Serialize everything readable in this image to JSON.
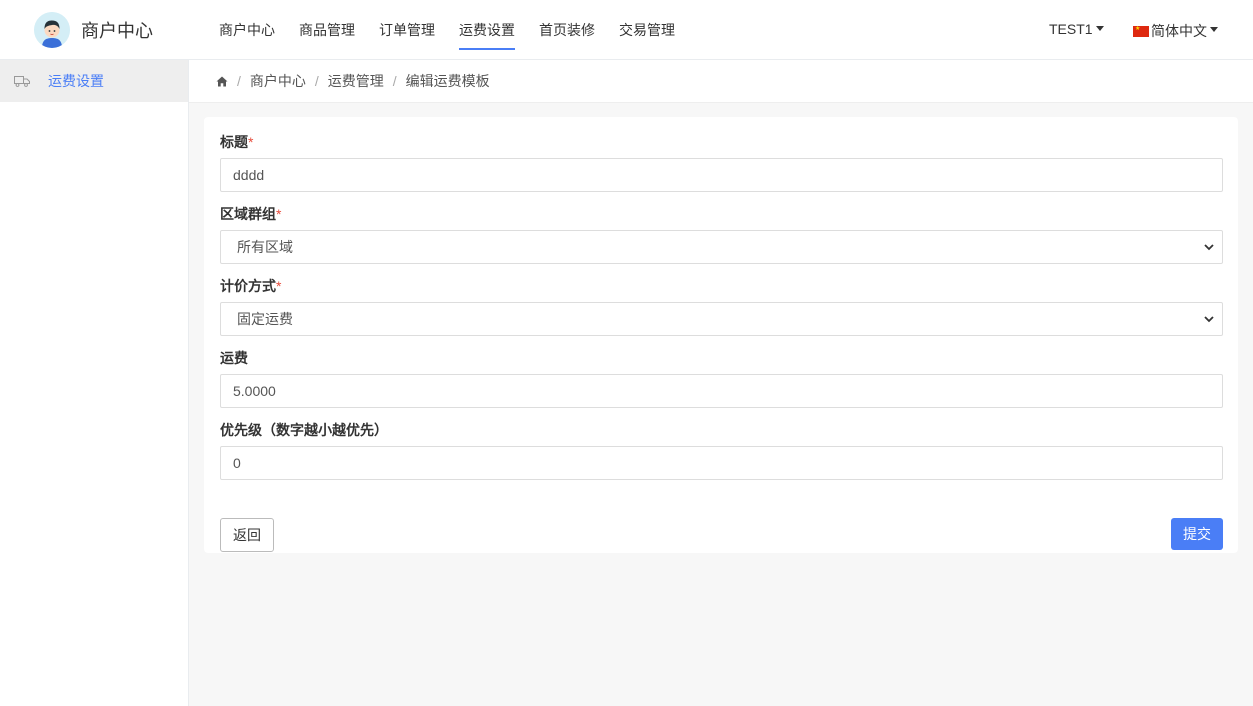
{
  "header": {
    "brand_title": "商户中心",
    "nav": [
      {
        "label": "商户中心",
        "active": false
      },
      {
        "label": "商品管理",
        "active": false
      },
      {
        "label": "订单管理",
        "active": false
      },
      {
        "label": "运费设置",
        "active": true
      },
      {
        "label": "首页装修",
        "active": false
      },
      {
        "label": "交易管理",
        "active": false
      }
    ],
    "user": "TEST1",
    "language": "简体中文"
  },
  "sidebar": {
    "items": [
      {
        "label": "运费设置",
        "icon": "truck-icon",
        "active": true
      }
    ]
  },
  "breadcrumb": {
    "items": [
      "商户中心",
      "运费管理",
      "编辑运费模板"
    ]
  },
  "form": {
    "title": {
      "label": "标题",
      "required_mark": "*",
      "value": "dddd"
    },
    "region": {
      "label": "区域群组",
      "required_mark": "*",
      "value": "所有区域"
    },
    "pricing": {
      "label": "计价方式",
      "required_mark": "*",
      "value": "固定运费"
    },
    "fee": {
      "label": "运费",
      "value": "5.0000"
    },
    "priority": {
      "label": "优先级（数字越小越优先）",
      "value": "0"
    }
  },
  "actions": {
    "back_label": "返回",
    "submit_label": "提交"
  },
  "colors": {
    "accent": "#4a7ef6",
    "required": "#e74c3c"
  }
}
